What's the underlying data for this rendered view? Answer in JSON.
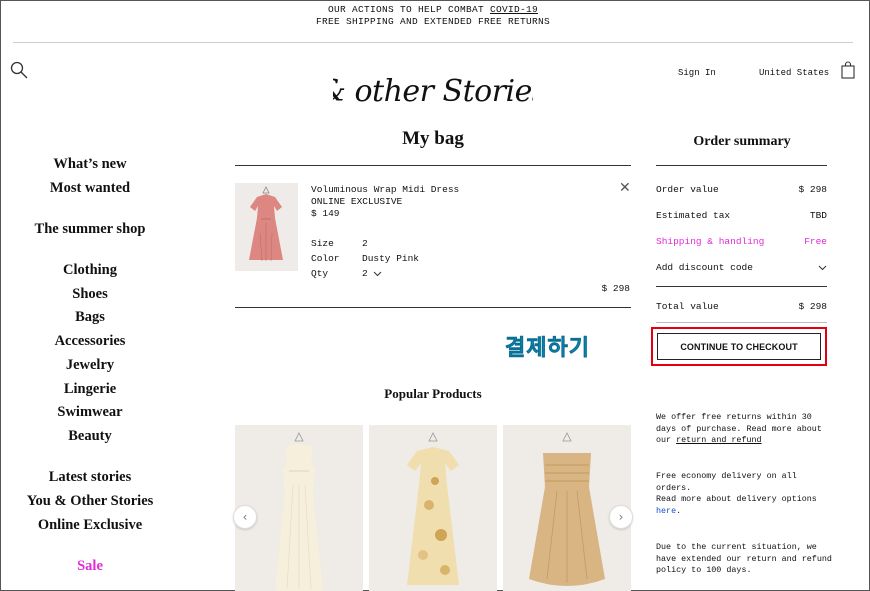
{
  "banner": {
    "line1_prefix": "OUR ACTIONS TO HELP COMBAT ",
    "line1_link": "COVID-19",
    "line2": "FREE SHIPPING AND EXTENDED FREE RETURNS"
  },
  "header": {
    "logo_text": "& other Stories",
    "sign_in": "Sign In",
    "country": "United States"
  },
  "nav": {
    "whats_new": "What’s new",
    "most_wanted": "Most wanted",
    "summer_shop": "The summer shop",
    "clothing": "Clothing",
    "shoes": "Shoes",
    "bags": "Bags",
    "accessories": "Accessories",
    "jewelry": "Jewelry",
    "lingerie": "Lingerie",
    "swimwear": "Swimwear",
    "beauty": "Beauty",
    "latest_stories": "Latest stories",
    "you_other_stories": "You & Other Stories",
    "online_exclusive": "Online Exclusive",
    "sale": "Sale"
  },
  "bag": {
    "title": "My bag",
    "item": {
      "name": "Voluminous Wrap Midi Dress",
      "tag": "ONLINE EXCLUSIVE",
      "price": "$ 149",
      "size_label": "Size",
      "size_value": "2",
      "color_label": "Color",
      "color_value": "Dusty Pink",
      "qty_label": "Qty",
      "qty_value": "2",
      "line_total": "$ 298",
      "close_symbol": "✕"
    }
  },
  "annotation": {
    "text": "결제하기"
  },
  "popular": {
    "title": "Popular Products",
    "prev_symbol": "‹",
    "next_symbol": "›"
  },
  "summary": {
    "title": "Order summary",
    "order_value_label": "Order value",
    "order_value": "$ 298",
    "tax_label": "Estimated tax",
    "tax_value": "TBD",
    "shipping_label": "Shipping & handling",
    "shipping_value": "Free",
    "discount_label": "Add discount code",
    "total_label": "Total value",
    "total_value": "$ 298",
    "checkout_button": "CONTINUE TO CHECKOUT"
  },
  "info": {
    "returns_text": "We offer free returns within 30 days of purchase. Read more about our ",
    "returns_link": "return and refund",
    "delivery_line1": "Free economy delivery on all orders.",
    "delivery_line2": "Read more about delivery options ",
    "delivery_link": "here",
    "delivery_end": ".",
    "policy_text": "Due to the current situation, we have extended our return and refund policy to 100 days."
  },
  "colors": {
    "accent_pink": "#e02bd6",
    "annotation_red": "#e2000f",
    "annotation_text": "#1aa3c9"
  }
}
